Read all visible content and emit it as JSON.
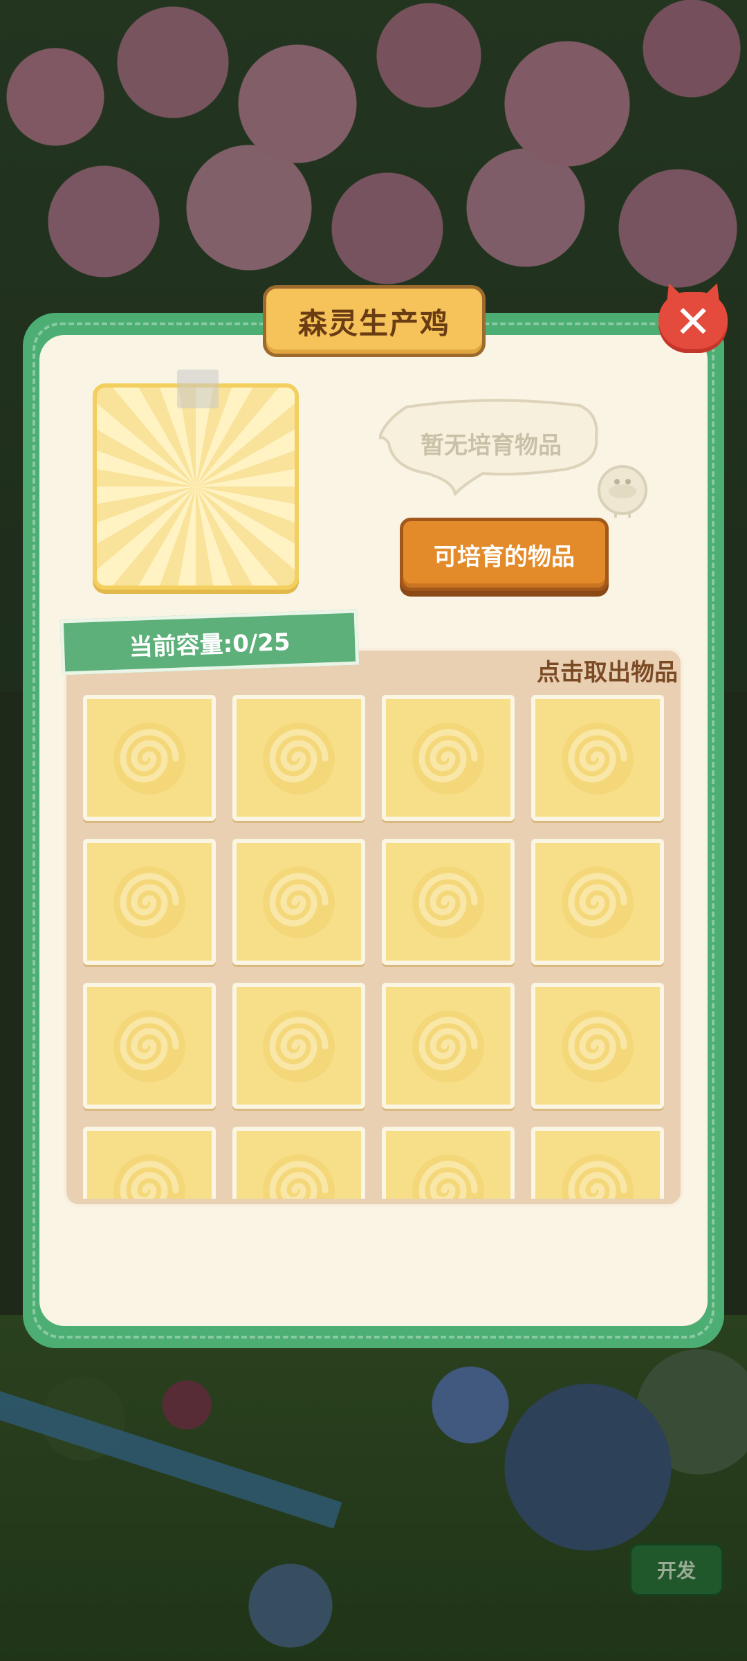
{
  "dialog": {
    "title": "森灵生产鸡",
    "close_icon": "close-icon"
  },
  "breeding": {
    "empty_message": "暂无培育物品",
    "breedable_items_button": "可培育的物品"
  },
  "inventory": {
    "capacity_label": "当前容量:0/25",
    "take_out_hint": "点击取出物品",
    "slots": [
      "",
      "",
      "",
      "",
      "",
      "",
      "",
      "",
      "",
      "",
      "",
      "",
      "",
      "",
      "",
      ""
    ]
  },
  "background": {
    "dev_button": "开发"
  },
  "colors": {
    "dialog_border": "#4cae72",
    "dialog_fill": "#f9f4e3",
    "title_plate": "#f6c25a",
    "close_button": "#e44b3c",
    "breed_button": "#e38b2b",
    "slot_fill": "#f7df8a"
  }
}
